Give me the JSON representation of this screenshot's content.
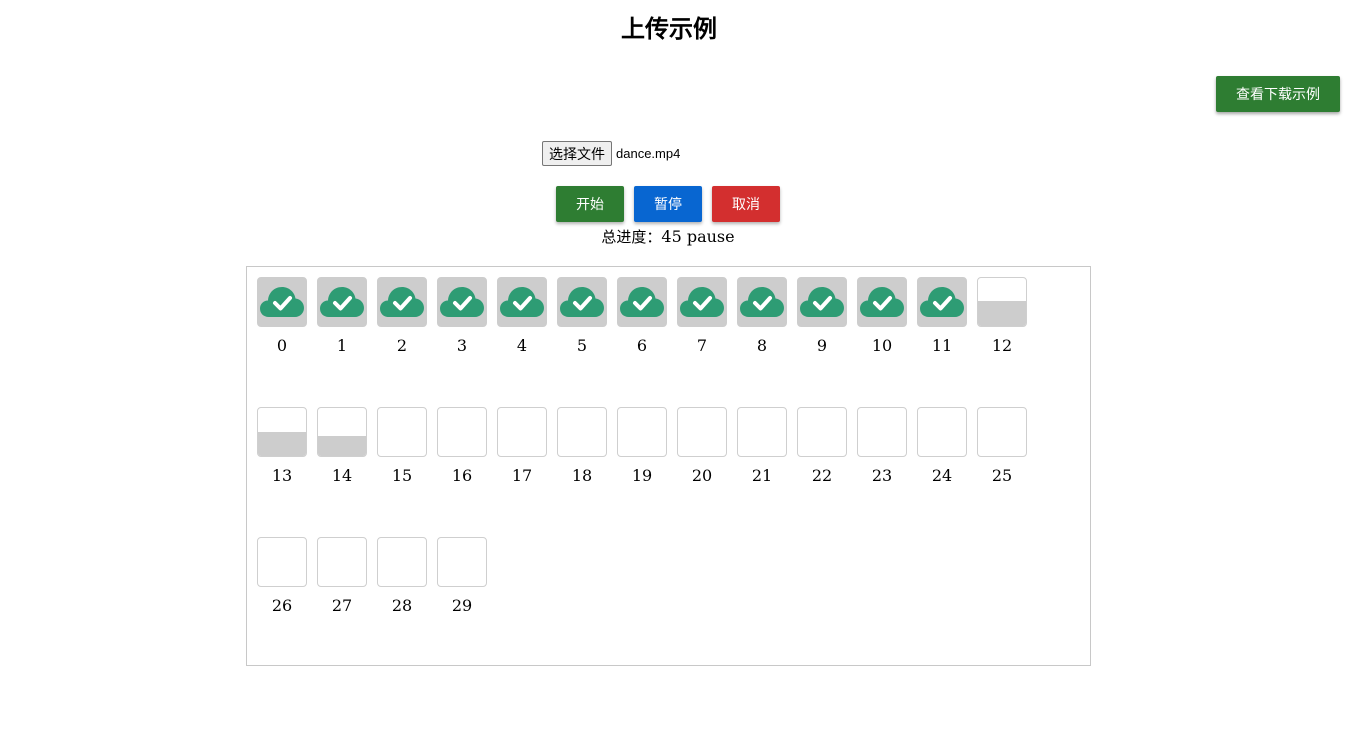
{
  "header": {
    "title": "上传示例"
  },
  "download_button": {
    "label": "查看下载示例"
  },
  "file": {
    "button_label": "选择文件",
    "file_name": "dance.mp4"
  },
  "controls": {
    "start": "开始",
    "pause": "暂停",
    "cancel": "取消"
  },
  "progress": {
    "label": "总进度：",
    "value": "45",
    "state": "pause"
  },
  "colors": {
    "green": "#2e7d32",
    "blue": "#0866d1",
    "red": "#d32f2f",
    "cloud": "#2e9c74"
  },
  "chunks": [
    {
      "label": "0",
      "status": "done",
      "progress": 1
    },
    {
      "label": "1",
      "status": "done",
      "progress": 1
    },
    {
      "label": "2",
      "status": "done",
      "progress": 1
    },
    {
      "label": "3",
      "status": "done",
      "progress": 1
    },
    {
      "label": "4",
      "status": "done",
      "progress": 1
    },
    {
      "label": "5",
      "status": "done",
      "progress": 1
    },
    {
      "label": "6",
      "status": "done",
      "progress": 1
    },
    {
      "label": "7",
      "status": "done",
      "progress": 1
    },
    {
      "label": "8",
      "status": "done",
      "progress": 1
    },
    {
      "label": "9",
      "status": "done",
      "progress": 1
    },
    {
      "label": "10",
      "status": "done",
      "progress": 1
    },
    {
      "label": "11",
      "status": "done",
      "progress": 1
    },
    {
      "label": "12",
      "status": "partial",
      "progress": 0.52
    },
    {
      "label": "13",
      "status": "partial",
      "progress": 0.5
    },
    {
      "label": "14",
      "status": "partial",
      "progress": 0.42
    },
    {
      "label": "15",
      "status": "pending",
      "progress": 0
    },
    {
      "label": "16",
      "status": "pending",
      "progress": 0
    },
    {
      "label": "17",
      "status": "pending",
      "progress": 0
    },
    {
      "label": "18",
      "status": "pending",
      "progress": 0
    },
    {
      "label": "19",
      "status": "pending",
      "progress": 0
    },
    {
      "label": "20",
      "status": "pending",
      "progress": 0
    },
    {
      "label": "21",
      "status": "pending",
      "progress": 0
    },
    {
      "label": "22",
      "status": "pending",
      "progress": 0
    },
    {
      "label": "23",
      "status": "pending",
      "progress": 0
    },
    {
      "label": "24",
      "status": "pending",
      "progress": 0
    },
    {
      "label": "25",
      "status": "pending",
      "progress": 0
    },
    {
      "label": "26",
      "status": "pending",
      "progress": 0
    },
    {
      "label": "27",
      "status": "pending",
      "progress": 0
    },
    {
      "label": "28",
      "status": "pending",
      "progress": 0
    },
    {
      "label": "29",
      "status": "pending",
      "progress": 0
    }
  ]
}
